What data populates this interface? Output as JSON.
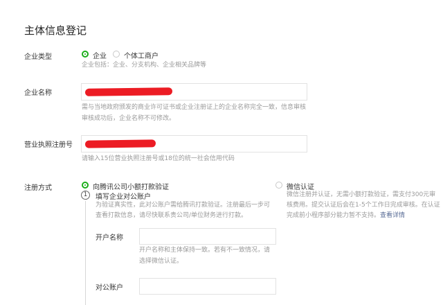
{
  "page": {
    "title": "主体信息登记"
  },
  "company_type": {
    "label": "企业类型",
    "options": [
      {
        "label": "企业",
        "selected": true
      },
      {
        "label": "个体工商户",
        "selected": false
      }
    ],
    "hint": "企业包括：企业、分支机构、企业相关品牌等"
  },
  "company_name": {
    "label": "企业名称",
    "value": "",
    "hint_line1": "需与当地政府颁发的商业许可证书或企业注册证上的企业名称完全一致，信息审核",
    "hint_line2": "审核成功后，企业名称不可修改。"
  },
  "license_number": {
    "label": "营业执照注册号",
    "value": "",
    "hint": "请输入15位营业执照注册号或18位的统一社会信用代码"
  },
  "registration": {
    "label": "注册方式",
    "option_tencent": "向腾讯公司小额打款验证",
    "step_number": "1",
    "step_title": "填写企业对公账户",
    "step_desc_line1": "为验证真实性，此对公账户需给腾讯打款验证。注册最后一步可",
    "step_desc_line2": "查看打款信息，请尽快联系贵公司/单位财务进行打款。",
    "account_name_label": "开户名称",
    "account_name_value": "",
    "account_name_hint_line1": "开户名称和主体保持一致。若有不一致情况，请",
    "account_name_hint_line2": "选择微信认证。",
    "account_number_label": "对公账户",
    "account_number_value": "",
    "option_wechat": "微信认证",
    "wechat_desc_line1": "微信注册并认证，无需小额打款验证，需支付300元审",
    "wechat_desc_line2": "核费用。提交认证后会在1-5个工作日完成审核。在认证",
    "wechat_desc_line3": "完成前小程序部分能力暂不支持。",
    "wechat_link": "查看详情"
  },
  "colors": {
    "accent_green": "#1aad19",
    "link_blue": "#576b95",
    "redaction_red": "#ec1c24",
    "hint_gray": "#9a9a9a"
  }
}
